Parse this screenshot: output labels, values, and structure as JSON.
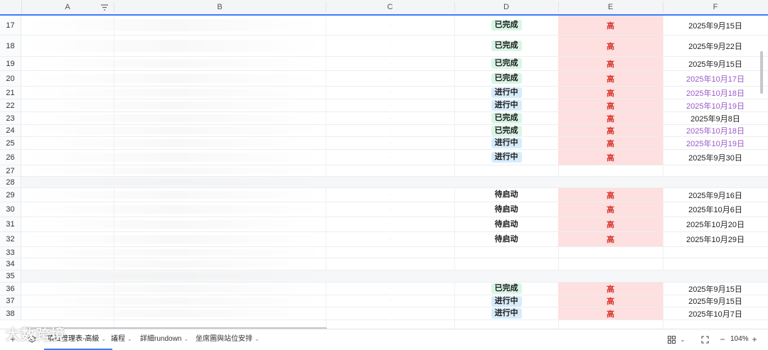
{
  "columns": [
    "A",
    "B",
    "C",
    "D",
    "E",
    "F"
  ],
  "rows": [
    {
      "num": "17",
      "status": "已完成",
      "priority": "高",
      "date": "2025年9月15日",
      "date_purple": false
    },
    {
      "num": "18",
      "status": "已完成",
      "priority": "高",
      "date": "2025年9月22日",
      "date_purple": false
    },
    {
      "num": "19",
      "status": "已完成",
      "priority": "高",
      "date": "2025年9月15日",
      "date_purple": false
    },
    {
      "num": "20",
      "status": "已完成",
      "priority": "高",
      "date": "2025年10月17日",
      "date_purple": true
    },
    {
      "num": "21",
      "status": "进行中",
      "priority": "高",
      "date": "2025年10月18日",
      "date_purple": true
    },
    {
      "num": "22",
      "status": "进行中",
      "priority": "高",
      "date": "2025年10月19日",
      "date_purple": true
    },
    {
      "num": "23",
      "status": "已完成",
      "priority": "高",
      "date": "2025年9月8日",
      "date_purple": false
    },
    {
      "num": "24",
      "status": "已完成",
      "priority": "高",
      "date": "2025年10月18日",
      "date_purple": true
    },
    {
      "num": "25",
      "status": "进行中",
      "priority": "高",
      "date": "2025年10月19日",
      "date_purple": true
    },
    {
      "num": "26",
      "status": "进行中",
      "priority": "高",
      "date": "2025年9月30日",
      "date_purple": false
    },
    {
      "num": "27",
      "status": "",
      "priority": "",
      "date": "",
      "date_purple": false
    },
    {
      "num": "28",
      "status": "",
      "priority": "",
      "date": "",
      "date_purple": false
    },
    {
      "num": "29",
      "status": "待启动",
      "priority": "高",
      "date": "2025年9月16日",
      "date_purple": false
    },
    {
      "num": "30",
      "status": "待启动",
      "priority": "高",
      "date": "2025年10月6日",
      "date_purple": false
    },
    {
      "num": "31",
      "status": "待启动",
      "priority": "高",
      "date": "2025年10月20日",
      "date_purple": false
    },
    {
      "num": "32",
      "status": "待启动",
      "priority": "高",
      "date": "2025年10月29日",
      "date_purple": false
    },
    {
      "num": "33",
      "status": "",
      "priority": "",
      "date": "",
      "date_purple": false
    },
    {
      "num": "34",
      "status": "",
      "priority": "",
      "date": "",
      "date_purple": false
    },
    {
      "num": "35",
      "status": "",
      "priority": "",
      "date": "",
      "date_purple": false
    },
    {
      "num": "36",
      "status": "已完成",
      "priority": "高",
      "date": "2025年9月15日",
      "date_purple": false
    },
    {
      "num": "37",
      "status": "进行中",
      "priority": "高",
      "date": "2025年9月15日",
      "date_purple": false
    },
    {
      "num": "38",
      "status": "进行中",
      "priority": "高",
      "date": "2025年10月7日",
      "date_purple": false
    }
  ],
  "tabs": [
    {
      "label": "項目管理表-高級"
    },
    {
      "label": "議程"
    },
    {
      "label": "詳細rundown"
    },
    {
      "label": "坐席圖與站位安排"
    }
  ],
  "zoom_label": "104%",
  "watermark": "大数跨境",
  "colors": {
    "accent": "#3b7cff",
    "high_bg": "#fde0df",
    "high_text": "#d93a34",
    "done_bg": "#d9f5e6",
    "progress_bg": "#d7ecfb",
    "purple_date": "#9b59c9"
  }
}
